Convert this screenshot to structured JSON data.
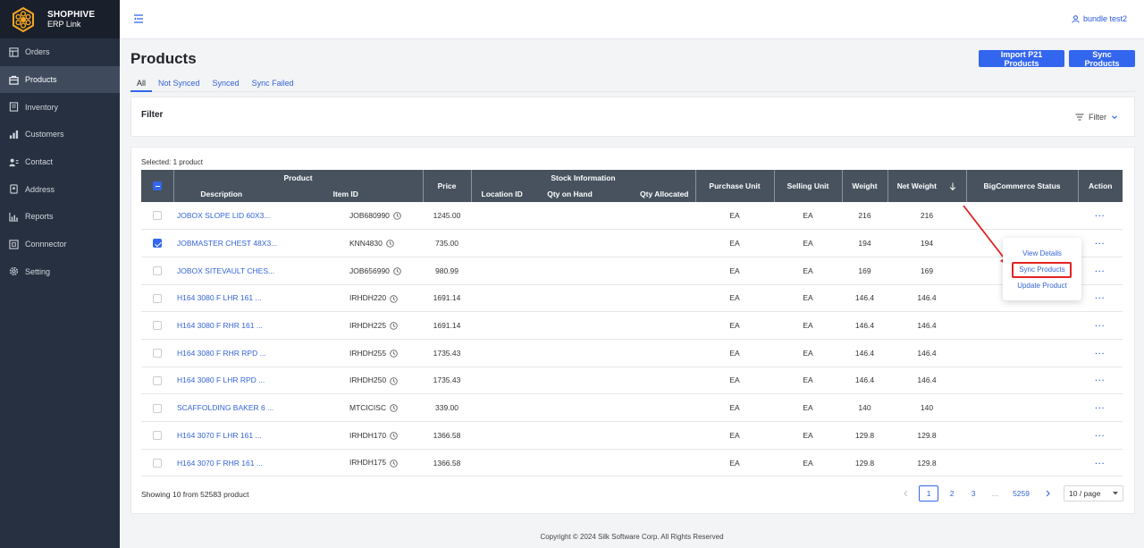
{
  "brand": {
    "name": "SHOPHIVE",
    "subtitle": "ERP Link"
  },
  "sidebar": {
    "items": [
      {
        "label": "Orders",
        "icon": "orders-icon"
      },
      {
        "label": "Products",
        "icon": "products-icon",
        "active": true
      },
      {
        "label": "Inventory",
        "icon": "inventory-icon"
      },
      {
        "label": "Customers",
        "icon": "customers-icon"
      },
      {
        "label": "Contact",
        "icon": "contact-icon"
      },
      {
        "label": "Address",
        "icon": "address-icon"
      },
      {
        "label": "Reports",
        "icon": "reports-icon"
      },
      {
        "label": "Connnector",
        "icon": "connector-icon"
      },
      {
        "label": "Setting",
        "icon": "gear-icon"
      }
    ]
  },
  "topbar": {
    "user": "bundle test2"
  },
  "page": {
    "title": "Products",
    "import_label": "Import P21 Products",
    "sync_label": "Sync Products"
  },
  "tabs": [
    "All",
    "Not Synced",
    "Synced",
    "Sync Failed"
  ],
  "filter": {
    "title": "Filter",
    "button": "Filter"
  },
  "table": {
    "selected_text": "Selected: 1 product",
    "headers": {
      "product": "Product",
      "description": "Description",
      "item_id": "Item ID",
      "price": "Price",
      "stock_info": "Stock Information",
      "location_id": "Location ID",
      "qty_on_hand": "Qty on Hand",
      "qty_allocated": "Qty Allocated",
      "purchase_unit": "Purchase Unit",
      "selling_unit": "Selling Unit",
      "weight": "Weight",
      "net_weight": "Net Weight",
      "bc_status": "BigCommerce Status",
      "action": "Action"
    },
    "rows": [
      {
        "description": "JOBOX SLOPE LID 60X3...",
        "item_id": "JOB680990",
        "price": "1245.00",
        "purchase_unit": "EA",
        "selling_unit": "EA",
        "weight": "216",
        "net_weight": "216",
        "checked": false
      },
      {
        "description": "JOBMASTER CHEST 48X3...",
        "item_id": "KNN4830",
        "price": "735.00",
        "purchase_unit": "EA",
        "selling_unit": "EA",
        "weight": "194",
        "net_weight": "194",
        "checked": true
      },
      {
        "description": "JOBOX SITEVAULT CHES...",
        "item_id": "JOB656990",
        "price": "980.99",
        "purchase_unit": "EA",
        "selling_unit": "EA",
        "weight": "169",
        "net_weight": "169",
        "checked": false
      },
      {
        "description": "H164 3080 F LHR 161 ...",
        "item_id": "IRHDH220",
        "price": "1691.14",
        "purchase_unit": "EA",
        "selling_unit": "EA",
        "weight": "146.4",
        "net_weight": "146.4",
        "checked": false
      },
      {
        "description": "H164 3080 F RHR 161 ...",
        "item_id": "IRHDH225",
        "price": "1691.14",
        "purchase_unit": "EA",
        "selling_unit": "EA",
        "weight": "146.4",
        "net_weight": "146.4",
        "checked": false
      },
      {
        "description": "H164 3080 F RHR RPD ...",
        "item_id": "IRHDH255",
        "price": "1735.43",
        "purchase_unit": "EA",
        "selling_unit": "EA",
        "weight": "146.4",
        "net_weight": "146.4",
        "checked": false
      },
      {
        "description": "H164 3080 F LHR RPD ...",
        "item_id": "IRHDH250",
        "price": "1735.43",
        "purchase_unit": "EA",
        "selling_unit": "EA",
        "weight": "146.4",
        "net_weight": "146.4",
        "checked": false
      },
      {
        "description": "SCAFFOLDING BAKER 6 ...",
        "item_id": "MTCICISC",
        "price": "339.00",
        "purchase_unit": "EA",
        "selling_unit": "EA",
        "weight": "140",
        "net_weight": "140",
        "checked": false
      },
      {
        "description": "H164 3070 F LHR 161 ...",
        "item_id": "IRHDH170",
        "price": "1366.58",
        "purchase_unit": "EA",
        "selling_unit": "EA",
        "weight": "129.8",
        "net_weight": "129.8",
        "checked": false
      },
      {
        "description": "H164 3070 F RHR 161 ...",
        "item_id": "IRHDH175",
        "price": "1366.58",
        "purchase_unit": "EA",
        "selling_unit": "EA",
        "weight": "129.8",
        "net_weight": "129.8",
        "checked": false
      }
    ],
    "action_label": "···"
  },
  "context_menu": {
    "items": [
      "View Details",
      "Sync Products",
      "Update Product"
    ],
    "highlight_color": "#e42222"
  },
  "pagination": {
    "showing": "Showing 10 from 52583 product",
    "pages": [
      "1",
      "2",
      "3"
    ],
    "ellipsis": "...",
    "last": "5259",
    "page_size": "10 / page"
  },
  "footer": {
    "copyright": "Copyright © 2024 Silk Software Corp. All Rights Reserved"
  },
  "colors": {
    "primary": "#3366ee",
    "sidebar": "#263040",
    "header": "#47525e",
    "link": "#3464d6"
  }
}
